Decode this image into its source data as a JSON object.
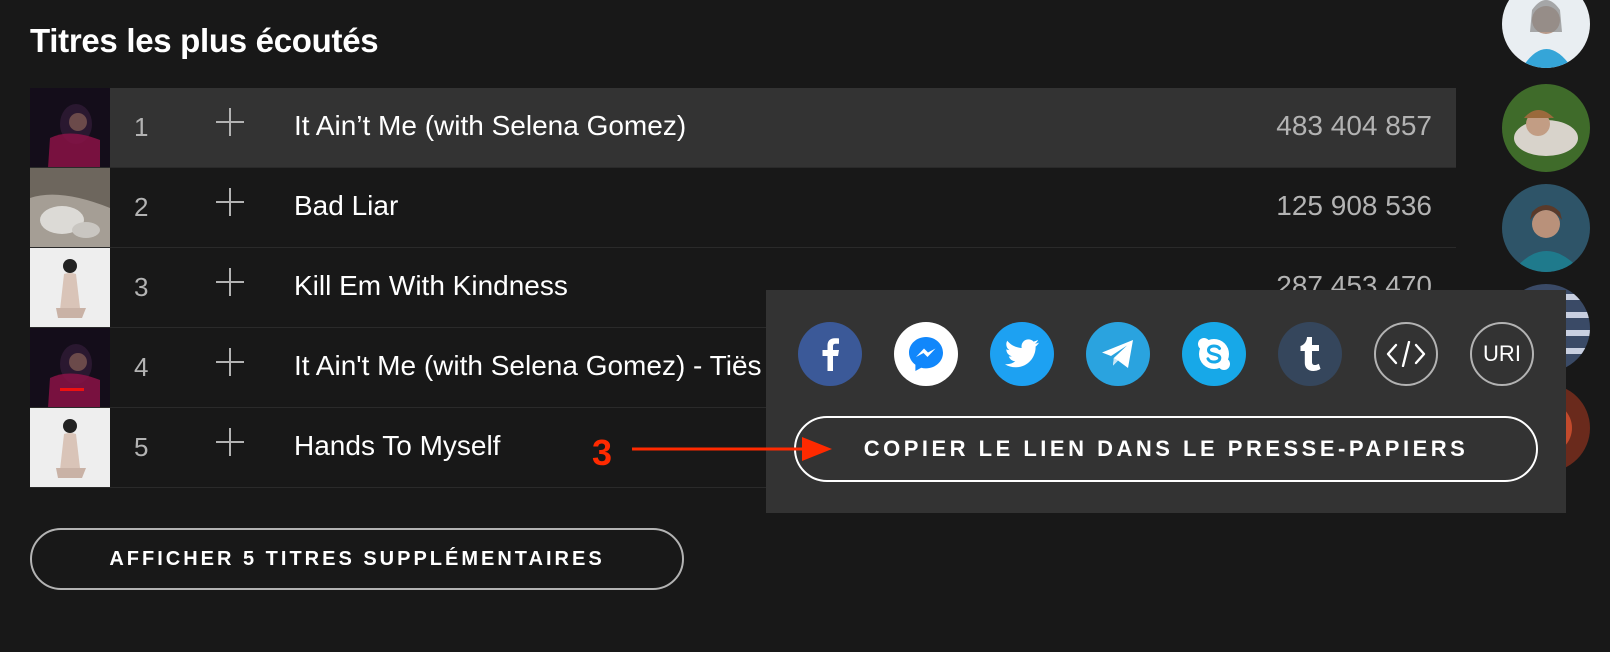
{
  "section_title": "Titres les plus écoutés",
  "tracks": [
    {
      "index": "1",
      "name": "It Ain’t Me (with Selena Gomez)",
      "plays": "483 404 857"
    },
    {
      "index": "2",
      "name": "Bad Liar",
      "plays": "125 908 536"
    },
    {
      "index": "3",
      "name": "Kill Em With Kindness",
      "plays": "287 453 470"
    },
    {
      "index": "4",
      "name": "It Ain't Me (with Selena Gomez) - Tiës",
      "plays": ""
    },
    {
      "index": "5",
      "name": "Hands To Myself",
      "plays": ""
    }
  ],
  "show_more_label": "AFFICHER 5 TITRES SUPPLÉMENTAIRES",
  "share_popup": {
    "options": [
      "facebook-icon",
      "messenger-icon",
      "twitter-icon",
      "telegram-icon",
      "skype-icon",
      "tumblr-icon",
      "embed-icon",
      "uri-icon"
    ],
    "uri_label": "URI",
    "copy_link_label": "COPIER LE LIEN DANS LE PRESSE-PAPIERS"
  },
  "annotation": {
    "step_number": "3"
  },
  "colors": {
    "background": "#181818",
    "row_hover": "#333333",
    "facebook": "#3b5998",
    "twitter": "#1da1f2",
    "telegram": "#2aa3df",
    "skype": "#17a8e8",
    "tumblr": "#35465c",
    "annotation": "#ff2a00"
  }
}
